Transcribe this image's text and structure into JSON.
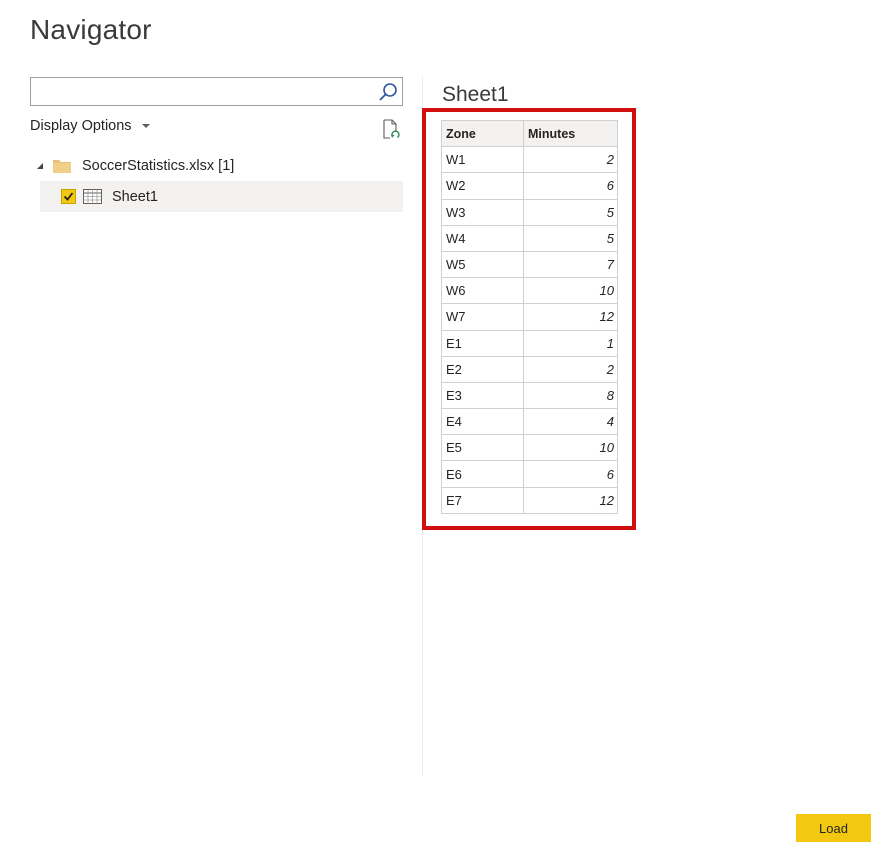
{
  "window": {
    "title": "Navigator"
  },
  "search": {
    "placeholder": "",
    "value": ""
  },
  "toolbar": {
    "display_options_label": "Display Options"
  },
  "tree": {
    "root_label": "SoccerStatistics.xlsx [1]",
    "items": [
      {
        "label": "Sheet1",
        "checked": true
      }
    ]
  },
  "preview": {
    "title": "Sheet1",
    "columns": [
      "Zone",
      "Minutes"
    ],
    "rows": [
      [
        "W1",
        "2"
      ],
      [
        "W2",
        "6"
      ],
      [
        "W3",
        "5"
      ],
      [
        "W4",
        "5"
      ],
      [
        "W5",
        "7"
      ],
      [
        "W6",
        "10"
      ],
      [
        "W7",
        "12"
      ],
      [
        "E1",
        "1"
      ],
      [
        "E2",
        "2"
      ],
      [
        "E3",
        "8"
      ],
      [
        "E4",
        "4"
      ],
      [
        "E5",
        "10"
      ],
      [
        "E6",
        "6"
      ],
      [
        "E7",
        "12"
      ]
    ]
  },
  "footer": {
    "load_label": "Load"
  },
  "colors": {
    "accent": "#f2c811",
    "highlight": "#d20f0f"
  },
  "icons": {
    "search": "search-icon",
    "caret": "caret-down-icon",
    "refresh": "refresh-document-icon",
    "expand": "expand-triangle-icon",
    "folder": "folder-icon",
    "sheet": "table-sheet-icon",
    "check": "checkmark-icon"
  }
}
